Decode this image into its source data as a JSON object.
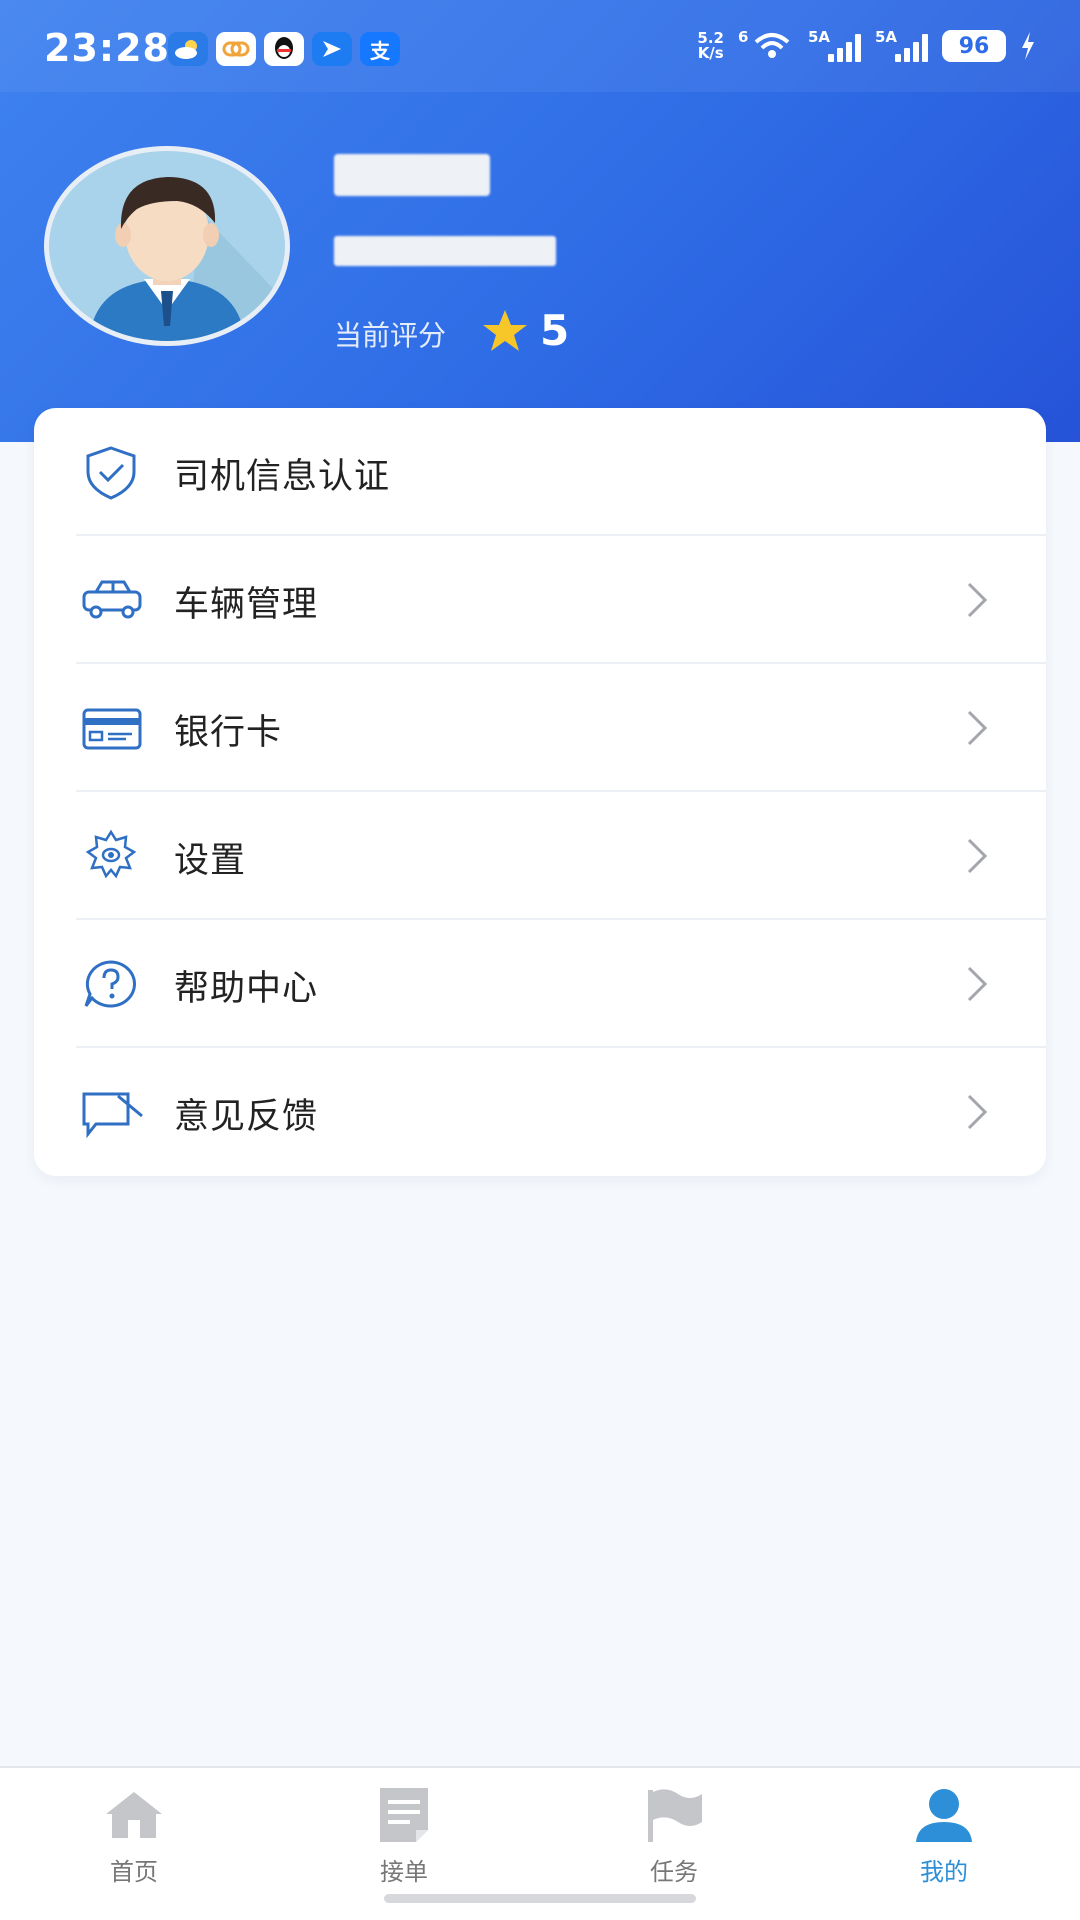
{
  "status_bar": {
    "time": "23:28",
    "net_speed_top": "5.2",
    "net_speed_bottom": "K/s",
    "wifi_label": "6",
    "sim1_label": "5A",
    "sim2_label": "5A",
    "battery": "96",
    "app_icons": [
      "weather-icon",
      "cloud-link-icon",
      "qq-icon",
      "send-icon",
      "alipay-icon"
    ],
    "alipay_glyph": "支"
  },
  "profile": {
    "rating_label": "当前评分",
    "rating_value": "5"
  },
  "menu": {
    "items": [
      {
        "label": "司机信息认证",
        "icon": "shield-check-icon",
        "has_chevron": false
      },
      {
        "label": "车辆管理",
        "icon": "car-icon",
        "has_chevron": true
      },
      {
        "label": "银行卡",
        "icon": "bank-card-icon",
        "has_chevron": true
      },
      {
        "label": "设置",
        "icon": "gear-icon",
        "has_chevron": true
      },
      {
        "label": "帮助中心",
        "icon": "help-icon",
        "has_chevron": true
      },
      {
        "label": "意见反馈",
        "icon": "feedback-icon",
        "has_chevron": true
      }
    ]
  },
  "bottom_nav": {
    "tabs": [
      {
        "label": "首页",
        "icon": "home-icon",
        "active": false
      },
      {
        "label": "接单",
        "icon": "order-list-icon",
        "active": false
      },
      {
        "label": "任务",
        "icon": "flag-icon",
        "active": false
      },
      {
        "label": "我的",
        "icon": "person-icon",
        "active": true
      }
    ]
  },
  "colors": {
    "header_start": "#3f82ef",
    "header_end": "#2653d8",
    "menu_icon": "#2f6fc4",
    "active_tab": "#2c8fd8",
    "inactive_tab": "#c4c6ca",
    "star": "#f7c72a"
  }
}
